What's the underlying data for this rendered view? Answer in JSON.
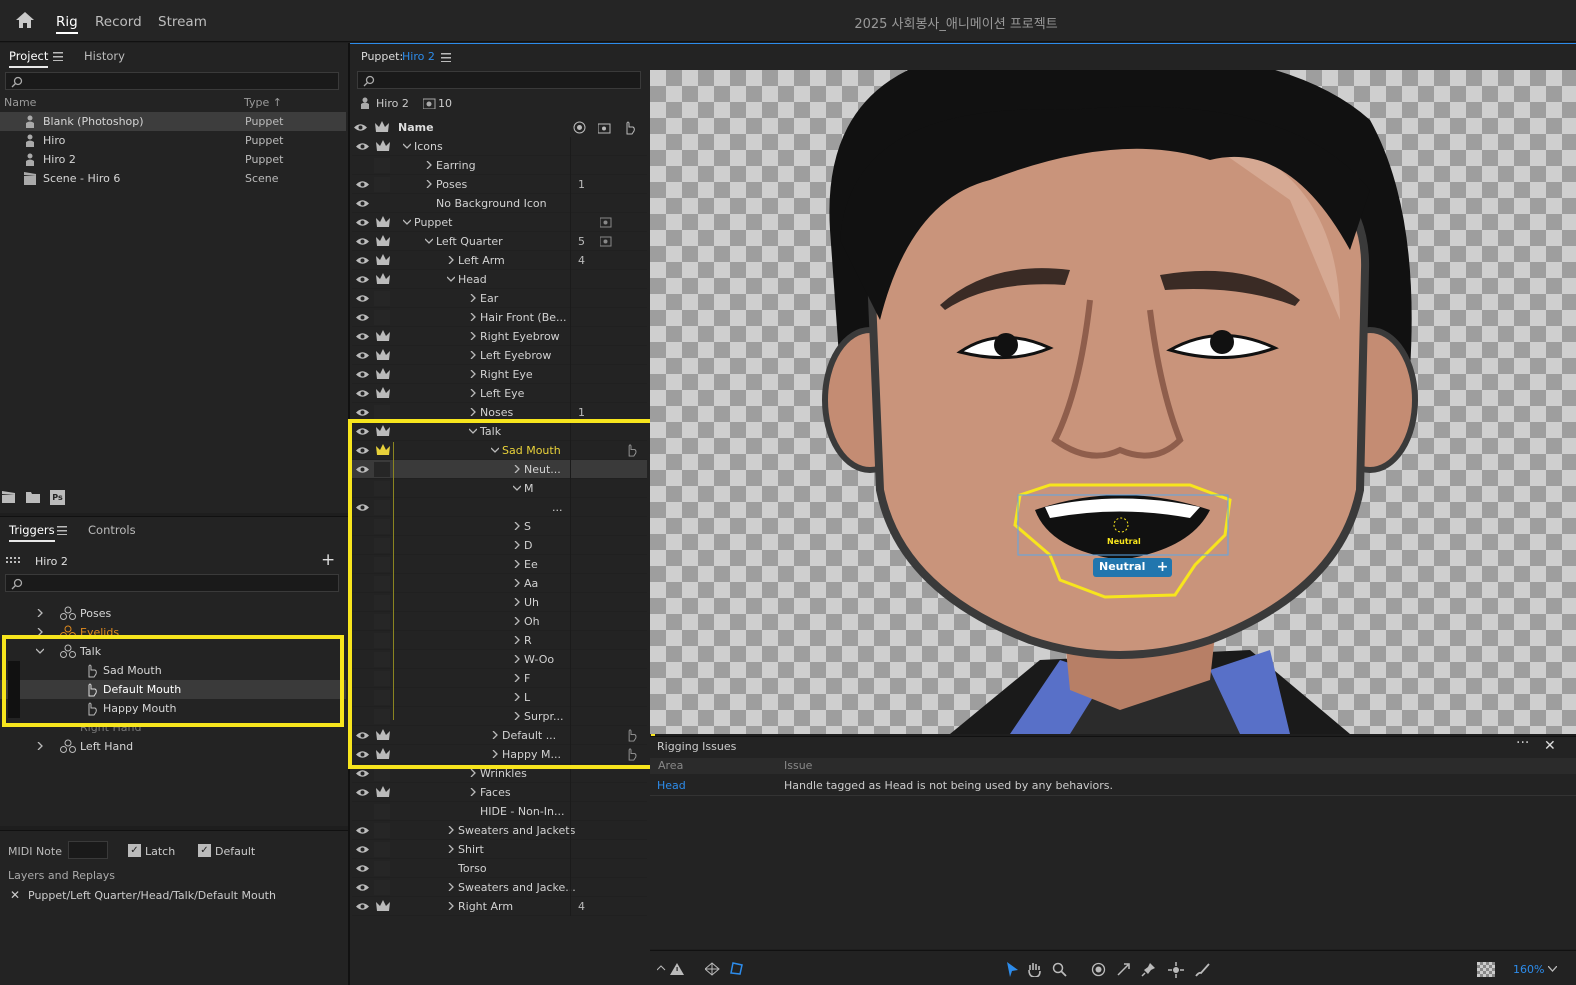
{
  "topbar": {
    "modes": [
      "Rig",
      "Record",
      "Stream"
    ],
    "title": "2025 사회봉사_애니메이션 프로젝트"
  },
  "project": {
    "tab1": "Project",
    "tab2": "History",
    "col_name": "Name",
    "col_type": "Type ↑",
    "items": [
      {
        "name": "Blank (Photoshop)",
        "type": "Puppet"
      },
      {
        "name": "Hiro",
        "type": "Puppet"
      },
      {
        "name": "Hiro 2",
        "type": "Puppet"
      },
      {
        "name": "Scene - Hiro 6",
        "type": "Scene"
      }
    ]
  },
  "triggers": {
    "tab1": "Triggers",
    "tab2": "Controls",
    "puppet": "Hiro 2",
    "rows": [
      {
        "label": "Poses"
      },
      {
        "label": "Eyelids"
      },
      {
        "label": "Talk"
      },
      {
        "label": "Sad Mouth"
      },
      {
        "label": "Default Mouth"
      },
      {
        "label": "Happy Mouth"
      },
      {
        "label": "Right Hand"
      },
      {
        "label": "Left Hand"
      }
    ],
    "midi_label": "MIDI Note",
    "latch": "Latch",
    "default": "Default",
    "layers_title": "Layers and Replays",
    "layer_path": "Puppet/Left Quarter/Head/Talk/Default Mouth"
  },
  "puppet_panel": {
    "label": "Puppet:",
    "name": "Hiro 2",
    "header_name": "Hiro 2",
    "header_count": "10",
    "col_name": "Name",
    "rows": [
      {
        "label": "Icons",
        "num": ""
      },
      {
        "label": "Earring",
        "num": ""
      },
      {
        "label": "Poses",
        "num": "1"
      },
      {
        "label": "No Background Icon",
        "num": ""
      },
      {
        "label": "Puppet",
        "num": ""
      },
      {
        "label": "Left Quarter",
        "num": "5"
      },
      {
        "label": "Left Arm",
        "num": "4"
      },
      {
        "label": "Head",
        "num": ""
      },
      {
        "label": "Ear",
        "num": ""
      },
      {
        "label": "Hair Front (Be...",
        "num": ""
      },
      {
        "label": "Right Eyebrow",
        "num": ""
      },
      {
        "label": "Left Eyebrow",
        "num": ""
      },
      {
        "label": "Right Eye",
        "num": ""
      },
      {
        "label": "Left Eye",
        "num": ""
      },
      {
        "label": "Noses",
        "num": "1"
      },
      {
        "label": "Talk",
        "num": ""
      },
      {
        "label": "Sad Mouth",
        "num": ""
      },
      {
        "label": "Neut...",
        "num": ""
      },
      {
        "label": "M",
        "num": ""
      },
      {
        "label": "...",
        "num": ""
      },
      {
        "label": "S",
        "num": ""
      },
      {
        "label": "D",
        "num": ""
      },
      {
        "label": "Ee",
        "num": ""
      },
      {
        "label": "Aa",
        "num": ""
      },
      {
        "label": "Uh",
        "num": ""
      },
      {
        "label": "Oh",
        "num": ""
      },
      {
        "label": "R",
        "num": ""
      },
      {
        "label": "W-Oo",
        "num": ""
      },
      {
        "label": "F",
        "num": ""
      },
      {
        "label": "L",
        "num": ""
      },
      {
        "label": "Surpr...",
        "num": ""
      },
      {
        "label": "Default ...",
        "num": ""
      },
      {
        "label": "Happy M...",
        "num": ""
      },
      {
        "label": "Wrinkles",
        "num": ""
      },
      {
        "label": "Faces",
        "num": ""
      },
      {
        "label": "HIDE - Non-In...",
        "num": ""
      },
      {
        "label": "Sweaters and Jackets",
        "num": ""
      },
      {
        "label": "Shirt",
        "num": ""
      },
      {
        "label": "Torso",
        "num": ""
      },
      {
        "label": "Sweaters and Jacke...",
        "num": ""
      },
      {
        "label": "Right Arm",
        "num": "4"
      }
    ]
  },
  "canvas": {
    "tag_small": "Neutral",
    "tag": "Neutral"
  },
  "issues": {
    "title": "Rigging Issues",
    "col_area": "Area",
    "col_issue": "Issue",
    "rows": [
      {
        "area": "Head",
        "issue": "Handle tagged as Head is not being used by any behaviors."
      }
    ]
  },
  "statusbar": {
    "zoom": "160%"
  },
  "colors": {
    "highlight": "#f7e51d",
    "accent": "#2d8ceb",
    "tag": "#2176ae"
  }
}
